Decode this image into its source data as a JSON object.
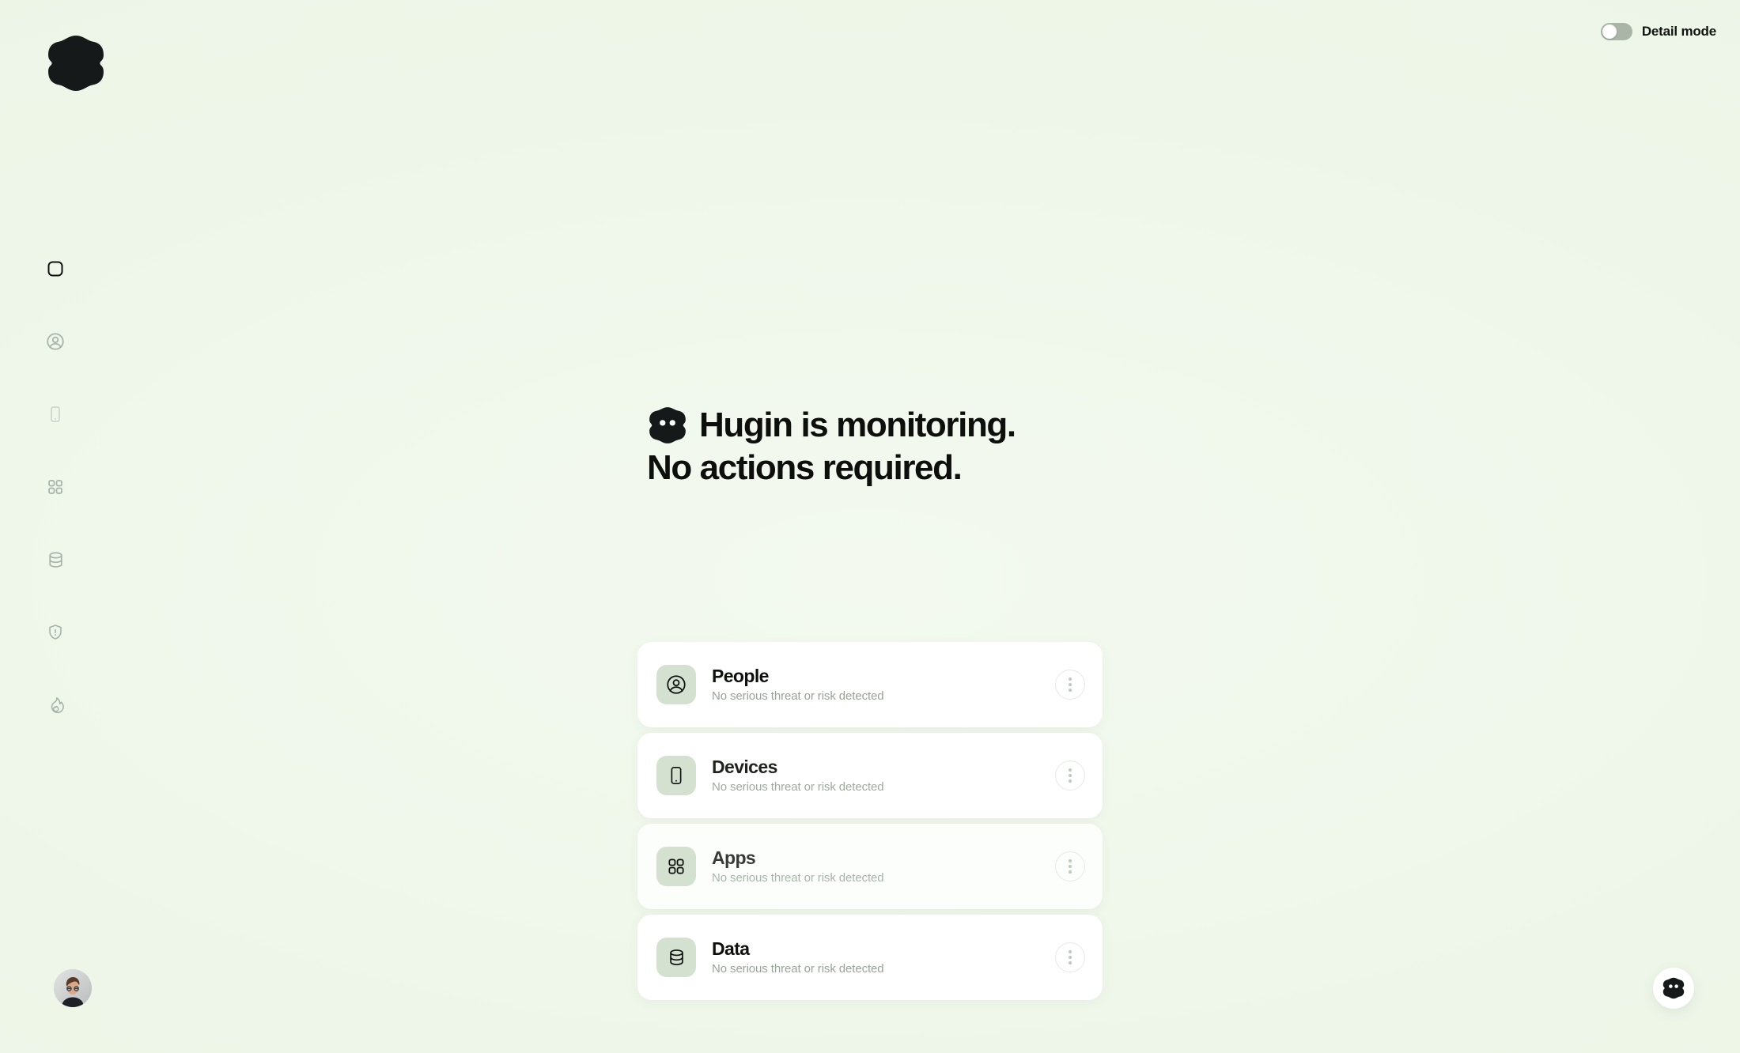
{
  "topbar": {
    "logo_icon": "hugin-blob-logo",
    "detail_mode": {
      "label": "Detail mode",
      "enabled": false,
      "state_text": "off"
    }
  },
  "sidebar": {
    "items": [
      {
        "name": "home",
        "icon": "rounded-square-icon",
        "active": true
      },
      {
        "name": "people",
        "icon": "person-circle-icon",
        "active": false
      },
      {
        "name": "devices",
        "icon": "phone-icon",
        "active": false
      },
      {
        "name": "apps",
        "icon": "grid-apps-icon",
        "active": false
      },
      {
        "name": "data",
        "icon": "database-icon",
        "active": false
      },
      {
        "name": "security",
        "icon": "shield-alert-icon",
        "active": false
      },
      {
        "name": "activity",
        "icon": "flame-icon",
        "active": false
      }
    ],
    "avatar": {
      "icon": "user-avatar",
      "alt": "User profile photo"
    }
  },
  "main": {
    "headline": {
      "mascot_icon": "hugin-mascot-icon",
      "line1": "Hugin is monitoring.",
      "line2": "No actions required."
    },
    "cards": [
      {
        "title": "People",
        "subtitle": "No serious threat or risk detected",
        "icon": "person-circle-icon",
        "menu_icon": "more-vertical-icon"
      },
      {
        "title": "Devices",
        "subtitle": "No serious threat or risk detected",
        "icon": "phone-icon",
        "menu_icon": "more-vertical-icon"
      },
      {
        "title": "Apps",
        "subtitle": "No serious threat or risk detected",
        "icon": "grid-apps-icon",
        "menu_icon": "more-vertical-icon"
      },
      {
        "title": "Data",
        "subtitle": "No serious threat or risk detected",
        "icon": "database-icon",
        "menu_icon": "more-vertical-icon"
      }
    ]
  },
  "chat": {
    "icon": "hugin-mascot-icon",
    "label": "Open Hugin assistant"
  },
  "colors": {
    "background": "#eff6ea",
    "card": "#ffffff",
    "icon_tile": "#d4e0d0",
    "text_primary": "#0d100d",
    "text_muted": "#98a398",
    "nav_idle": "#a7b3a8",
    "nav_active": "#0e110e",
    "toggle_track": "#aab5a8"
  }
}
